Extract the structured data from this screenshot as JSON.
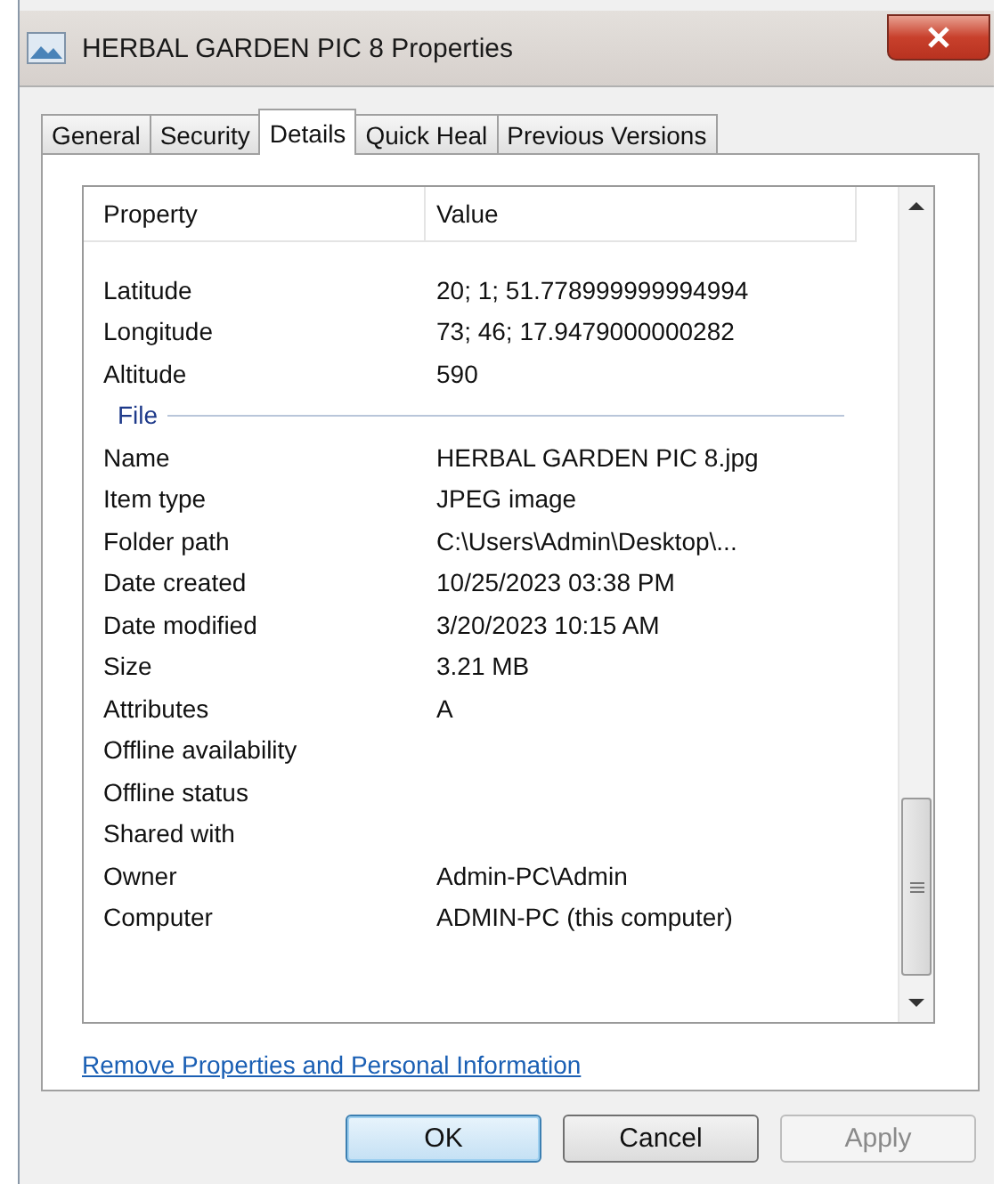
{
  "window": {
    "title": "HERBAL GARDEN PIC 8 Properties"
  },
  "tabs": [
    {
      "label": "General",
      "selected": false
    },
    {
      "label": "Security",
      "selected": false
    },
    {
      "label": "Details",
      "selected": true
    },
    {
      "label": "Quick Heal",
      "selected": false
    },
    {
      "label": "Previous Versions",
      "selected": false
    }
  ],
  "table": {
    "columns": [
      "Property",
      "Value"
    ],
    "rows": [
      {
        "kind": "row",
        "property": "Latitude",
        "value": "20; 1; 51.778999999994994"
      },
      {
        "kind": "row",
        "property": "Longitude",
        "value": "73; 46; 17.9479000000282"
      },
      {
        "kind": "row",
        "property": "Altitude",
        "value": "590"
      },
      {
        "kind": "section",
        "property": "File"
      },
      {
        "kind": "row",
        "property": "Name",
        "value": "HERBAL GARDEN PIC 8.jpg"
      },
      {
        "kind": "row",
        "property": "Item type",
        "value": "JPEG image"
      },
      {
        "kind": "row",
        "property": "Folder path",
        "value": "C:\\Users\\Admin\\Desktop\\..."
      },
      {
        "kind": "row",
        "property": "Date created",
        "value": "10/25/2023 03:38 PM"
      },
      {
        "kind": "row",
        "property": "Date modified",
        "value": "3/20/2023 10:15 AM"
      },
      {
        "kind": "row",
        "property": "Size",
        "value": "3.21 MB"
      },
      {
        "kind": "row",
        "property": "Attributes",
        "value": "A"
      },
      {
        "kind": "row",
        "property": "Offline availability"
      },
      {
        "kind": "row",
        "property": "Offline status"
      },
      {
        "kind": "row",
        "property": "Shared with"
      },
      {
        "kind": "row",
        "property": "Owner",
        "value": "Admin-PC\\Admin"
      },
      {
        "kind": "row",
        "property": "Computer",
        "value": "ADMIN-PC (this computer)"
      }
    ]
  },
  "link": "Remove Properties and Personal Information",
  "buttons": [
    {
      "label": "OK",
      "default": true,
      "disabled": false
    },
    {
      "label": "Cancel",
      "default": false,
      "disabled": false
    },
    {
      "label": "Apply",
      "default": false,
      "disabled": true
    }
  ]
}
